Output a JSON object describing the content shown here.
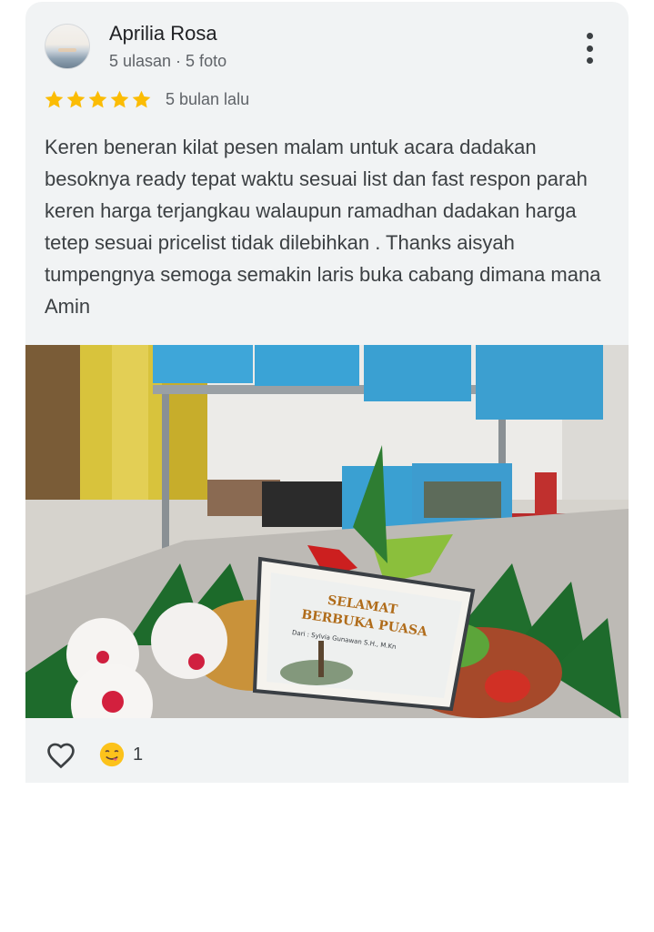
{
  "review": {
    "author": "Aprilia Rosa",
    "author_meta": "5 ulasan · 5 foto",
    "rating": 5,
    "max_rating": 5,
    "time_ago": "5 bulan lalu",
    "text": "Keren beneran kilat pesen malam untuk acara dadakan besoknya ready tepat waktu sesuai list dan fast respon parah keren harga terjangkau walaupun ramadhan dadakan harga tetep sesuai pricelist tidak dilebihkan . Thanks aisyah tumpengnya semoga semakin laris buka cabang dimana mana Amin",
    "photo": {
      "card_line1": "SELAMAT",
      "card_line2": "BERBUKA PUASA",
      "card_from": "Dari : Sylvia Gunawan S.H., M.Kn"
    },
    "reaction_count": "1"
  },
  "icons": {
    "menu": "more-vert-icon",
    "star": "star-icon",
    "like": "heart-outline-icon",
    "reaction": "yum-emoji-icon"
  },
  "colors": {
    "star": "#fbbc04",
    "card_bg": "#f1f3f4",
    "secondary_text": "#5f6368"
  }
}
